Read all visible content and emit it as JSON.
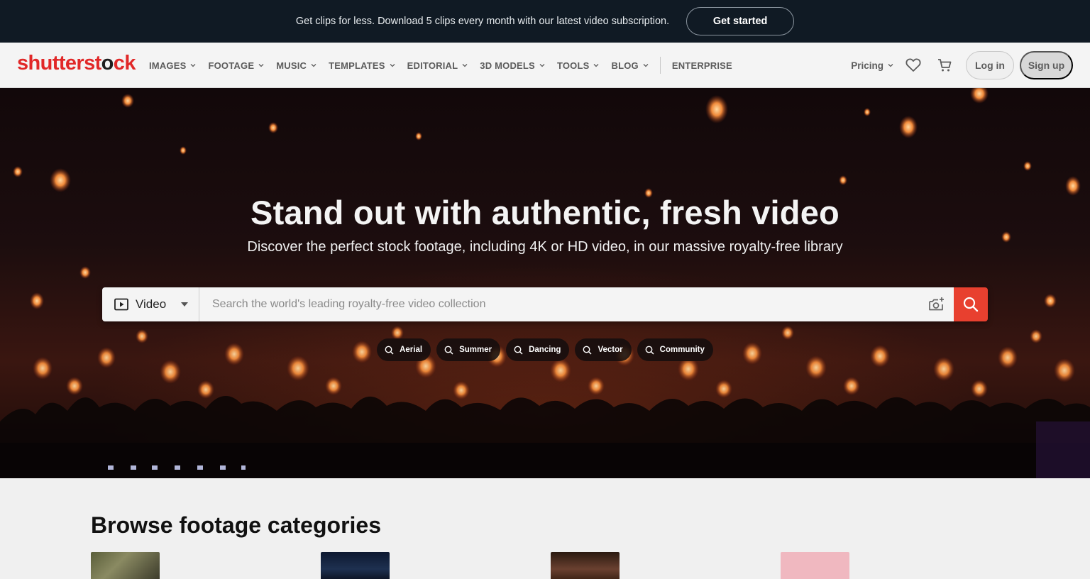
{
  "promo": {
    "text": "Get clips for less. Download 5 clips every month with our latest video subscription.",
    "cta": "Get started"
  },
  "header": {
    "logo": {
      "part1": "shutterst",
      "part2": "o",
      "part3": "ck",
      "colors": {
        "brand_red": "#e12828",
        "dark": "#1e1e1e"
      }
    },
    "nav": [
      {
        "label": "IMAGES"
      },
      {
        "label": "FOOTAGE"
      },
      {
        "label": "MUSIC"
      },
      {
        "label": "TEMPLATES"
      },
      {
        "label": "EDITORIAL"
      },
      {
        "label": "3D MODELS"
      },
      {
        "label": "TOOLS"
      },
      {
        "label": "BLOG"
      }
    ],
    "enterprise": "ENTERPRISE",
    "pricing": "Pricing",
    "icons": {
      "favorites": "heart-icon",
      "cart": "cart-icon"
    },
    "login": "Log in",
    "signup": "Sign up"
  },
  "hero": {
    "title": "Stand out with authentic, fresh video",
    "subtitle": "Discover the perfect stock footage, including 4K or HD video, in our massive royalty-free library",
    "search": {
      "type_label": "Video",
      "placeholder": "Search the world's leading royalty-free video collection",
      "value": "",
      "accent": "#e8402f"
    },
    "chips": [
      {
        "label": "Aerial"
      },
      {
        "label": "Summer"
      },
      {
        "label": "Dancing"
      },
      {
        "label": "Vector"
      },
      {
        "label": "Community"
      }
    ]
  },
  "browse": {
    "title": "Browse footage categories"
  }
}
